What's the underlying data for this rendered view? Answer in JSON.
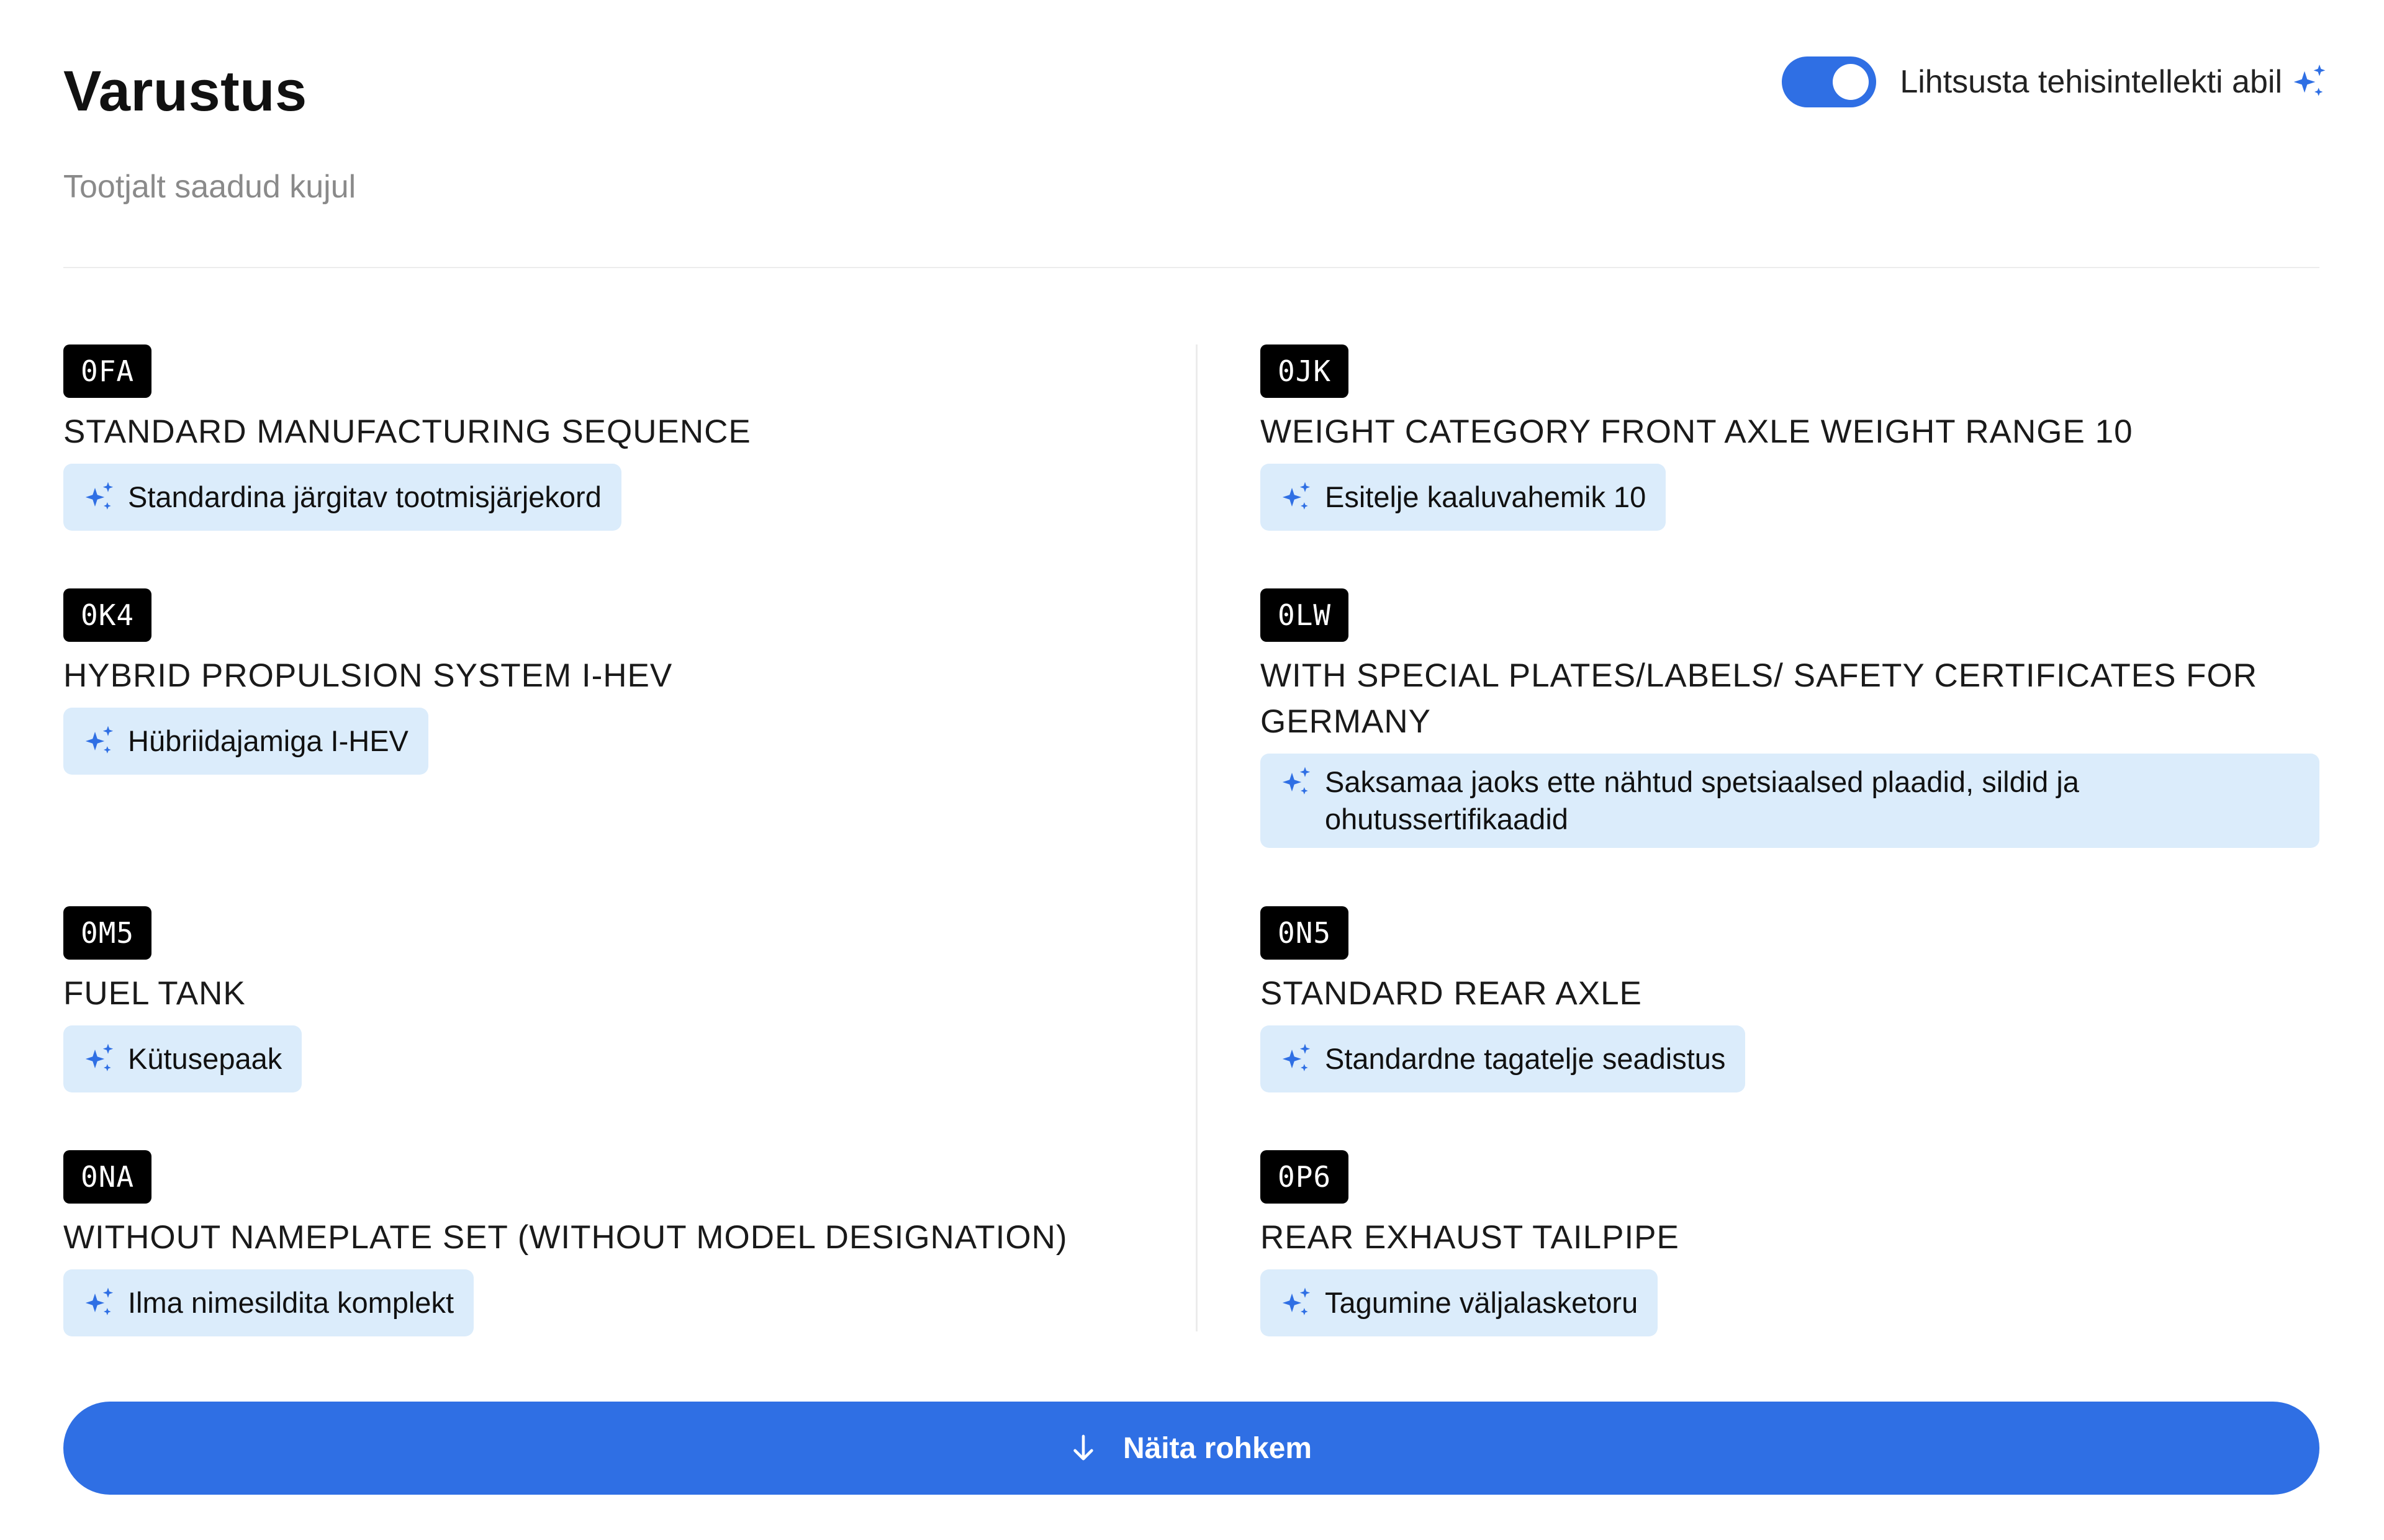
{
  "header": {
    "title": "Varustus",
    "subtitle": "Tootjalt saadud kujul",
    "ai_toggle": {
      "label": "Lihtsusta tehisintellekti abil",
      "on": true
    }
  },
  "colors": {
    "accent": "#2f6fe4",
    "chip_bg": "#dbecfb",
    "code_bg": "#000000"
  },
  "items": [
    {
      "code": "0FA",
      "original": "STANDARD MANUFACTURING SEQUENCE",
      "simplified": "Standardina järgitav tootmisjärjekord"
    },
    {
      "code": "0JK",
      "original": "WEIGHT CATEGORY FRONT AXLE WEIGHT RANGE 10",
      "simplified": "Esitelje kaaluvahemik 10"
    },
    {
      "code": "0K4",
      "original": "HYBRID PROPULSION SYSTEM I-HEV",
      "simplified": "Hübriidajamiga I-HEV"
    },
    {
      "code": "0LW",
      "original": "WITH SPECIAL PLATES/LABELS/ SAFETY CERTIFICATES FOR GERMANY",
      "simplified": "Saksamaa jaoks ette nähtud spetsiaalsed plaadid, sildid ja ohutussertifikaadid"
    },
    {
      "code": "0M5",
      "original": "FUEL TANK",
      "simplified": "Kütusepaak"
    },
    {
      "code": "0N5",
      "original": "STANDARD REAR AXLE",
      "simplified": "Standardne tagatelje seadistus"
    },
    {
      "code": "0NA",
      "original": "WITHOUT NAMEPLATE SET (WITHOUT MODEL DESIGNATION)",
      "simplified": "Ilma nimesildita komplekt"
    },
    {
      "code": "0P6",
      "original": "REAR EXHAUST TAILPIPE",
      "simplified": "Tagumine väljalasketoru"
    }
  ],
  "show_more": {
    "label": "Näita rohkem",
    "icon": "arrow-down-icon"
  },
  "icons": {
    "ai": "sparkle-icon"
  }
}
